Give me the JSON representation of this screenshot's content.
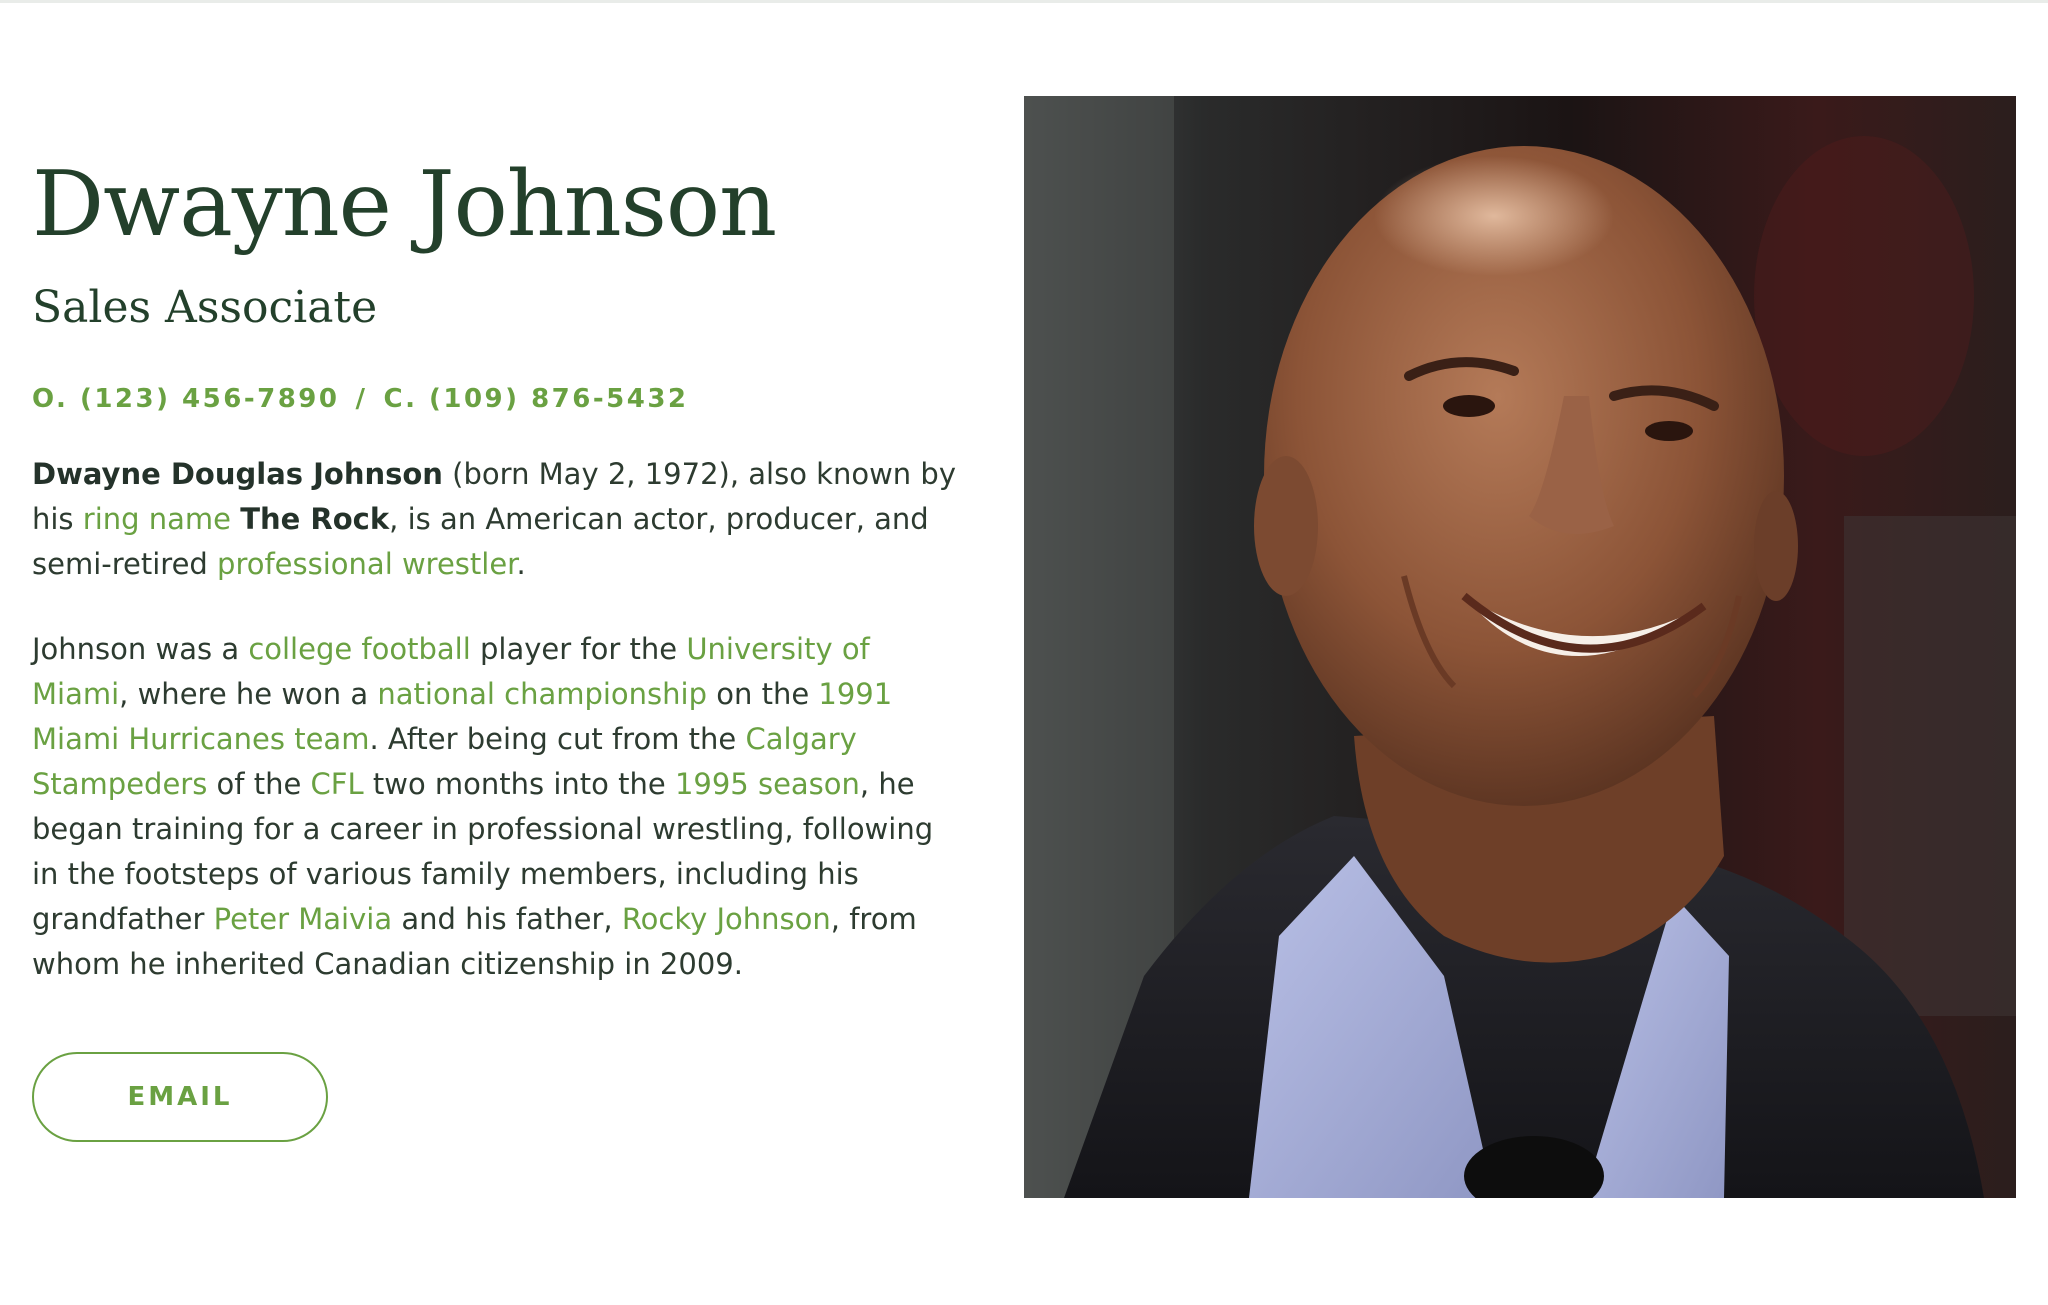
{
  "profile": {
    "name": "Dwayne Johnson",
    "title": "Sales Associate",
    "phones": {
      "office": "O. (123) 456-7890",
      "separator": "/",
      "cell": "C. (109) 876-5432"
    },
    "bio": {
      "p1": {
        "bold_name": "Dwayne Douglas Johnson",
        "t1": " (born May 2, 1972), also known by his ",
        "link_ring_name": "ring name",
        "t2": " ",
        "bold_rock": "The Rock",
        "t3": ", is an American actor, producer, and semi-retired ",
        "link_pro_wrestler": "professional wrestler",
        "t4": "."
      },
      "p2": {
        "t1": "Johnson was a ",
        "link_college_football": "college football",
        "t2": " player for the ",
        "link_univ_miami": "University of Miami",
        "t3": ", where he won a ",
        "link_national_championship": "national championship",
        "t4": " on the ",
        "link_1991_team": "1991 Miami Hurricanes team",
        "t5": ". After being cut from the ",
        "link_calgary": "Calgary Stampeders",
        "t6": " of the ",
        "link_cfl": "CFL",
        "t7": " two months into the ",
        "link_1995_season": "1995 season",
        "t8": ", he began training for a career in professional wrestling, following in the footsteps of various family members, including his grandfather ",
        "link_peter_maivia": "Peter Maivia",
        "t9": " and his father, ",
        "link_rocky_johnson": "Rocky Johnson",
        "t10": ", from whom he inherited Canadian citizenship in 2009."
      }
    },
    "email_button": "EMAIL"
  },
  "colors": {
    "accent_green": "#6aa142",
    "heading_dark_green": "#23402b",
    "body_text": "#2d3b30"
  }
}
